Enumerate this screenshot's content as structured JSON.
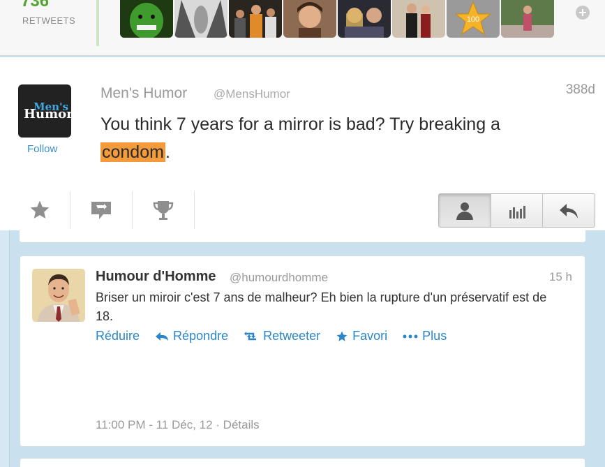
{
  "retweets": {
    "count": "736",
    "label": "RETWEETS",
    "avatars": [
      "hulk-avatar",
      "face-closeup-avatar",
      "group-photo-avatar",
      "smiling-guy-avatar",
      "couple-selfie-avatar",
      "couple-portrait-avatar",
      "star-100-avatar",
      "person-outdoor-avatar"
    ],
    "star_badge": "100"
  },
  "featured": {
    "logo_line1": "Men's",
    "logo_line2": "Humor",
    "follow_label": "Follow",
    "name": "Men's Humor",
    "handle": "@MensHumor",
    "age": "388d",
    "text_before": "You think 7 years for a mirror is bad? Try breaking a ",
    "text_highlight": "condom",
    "text_after": ".",
    "highlight_color": "#f39a3b"
  },
  "tweet": {
    "name": "Humour d'Homme",
    "handle": "@humourdhomme",
    "time": "15 h",
    "text": "Briser un miroir c'est 7 ans de malheur? Eh bien la rupture d'un préservatif est de 18.",
    "actions": {
      "collapse": "Réduire",
      "reply": "Répondre",
      "retweet": "Retweeter",
      "favorite": "Favori",
      "more": "Plus"
    },
    "meta": "11:00 PM - 11 Déc, 12 · Détails",
    "link_color": "#2b86c5"
  }
}
